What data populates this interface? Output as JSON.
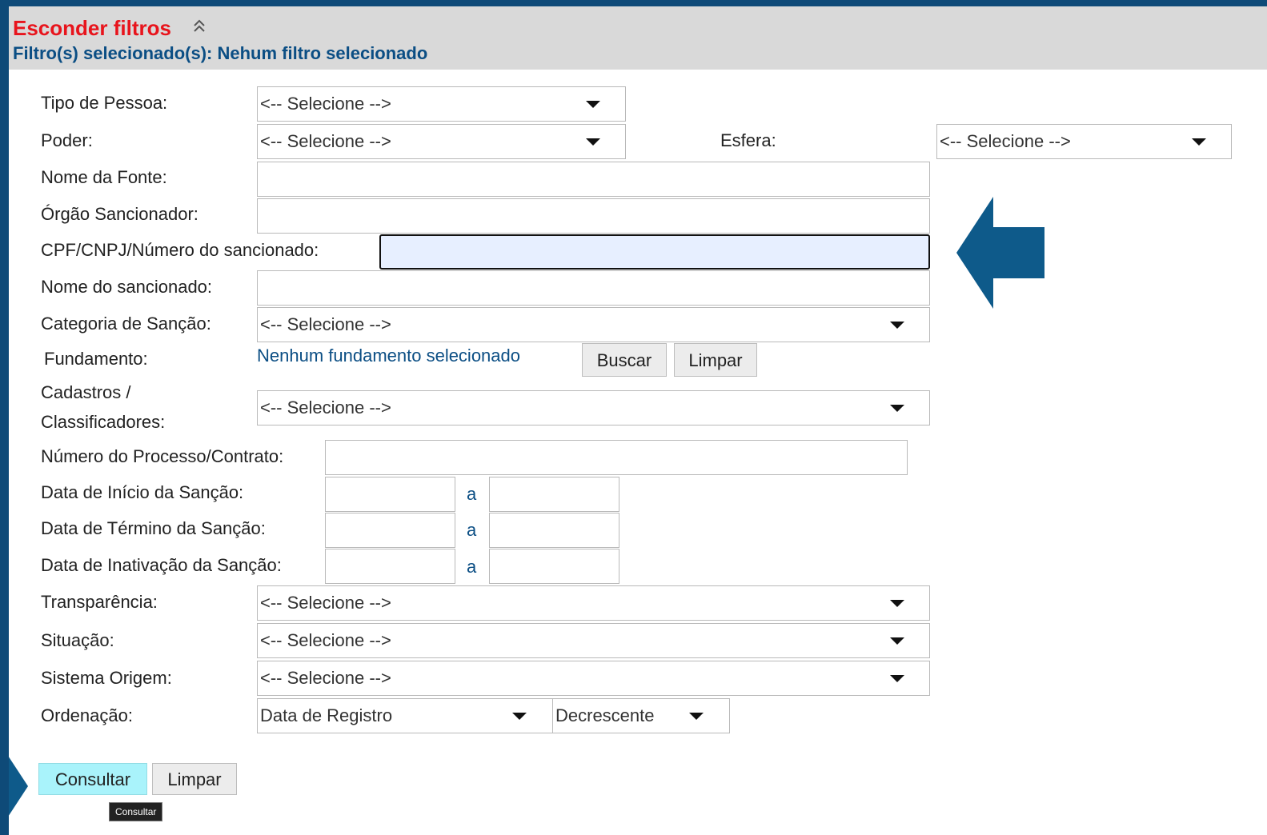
{
  "header": {
    "hide_filters": "Esconder filtros",
    "selected_filters": "Filtro(s) selecionado(s): Nehum filtro selecionado"
  },
  "placeholder_select": "<-- Selecione -->",
  "labels": {
    "tipo_pessoa": "Tipo de Pessoa:",
    "poder": "Poder:",
    "esfera": "Esfera:",
    "nome_fonte": "Nome da Fonte:",
    "orgao": "Órgão Sancionador:",
    "cpf": "CPF/CNPJ/Número do sancionado:",
    "nome_sancionado": "Nome do sancionado:",
    "categoria": "Categoria de Sanção:",
    "fundamento": "Fundamento:",
    "cadastros_1": "Cadastros /",
    "cadastros_2": "Classificadores:",
    "processo": "Número do Processo/Contrato:",
    "data_inicio": "Data de Início da Sanção:",
    "data_termino": "Data de Término da Sanção:",
    "data_inativacao": "Data de Inativação da Sanção:",
    "transparencia": "Transparência:",
    "situacao": "Situação:",
    "sistema_origem": "Sistema Origem:",
    "ordenacao": "Ordenação:"
  },
  "fundamento": {
    "status": "Nenhum fundamento selecionado",
    "search_label": "Buscar",
    "clear_label": "Limpar"
  },
  "date_separator": "a",
  "ordenacao": {
    "field": "Data de Registro",
    "direction": "Decrescente"
  },
  "actions": {
    "submit_label": "Consultar",
    "clear_label": "Limpar",
    "tooltip": "Consultar"
  },
  "colors": {
    "accent_red": "#e8141c",
    "link_blue": "#0b4e84",
    "frame_blue": "#0e4a78",
    "primary_button": "#a9f3fb"
  }
}
